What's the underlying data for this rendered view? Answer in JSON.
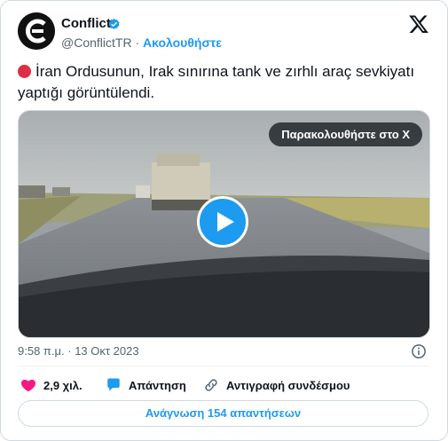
{
  "author": {
    "name": "Conflict",
    "handle": "@ConflictTR",
    "separator": "·",
    "follow_label": "Ακολουθήστε",
    "verified": true
  },
  "tweet": {
    "text": "İran Ordusunun, Irak sınırına tank ve zırhlı araç sevkiyatı yaptığı görüntülendi.",
    "emoji": "red-circle"
  },
  "media": {
    "watch_label": "Παρακολουθήστε στο X",
    "play_icon": "play-icon"
  },
  "meta": {
    "time": "9:58 π.μ.",
    "separator": "·",
    "date": "13 Οκτ 2023"
  },
  "actions": {
    "likes": "2,9 χιλ.",
    "reply": "Απάντηση",
    "copy_link": "Αντιγραφή συνδέσμου"
  },
  "read_replies": "Ανάγνωση 154 απαντήσεων",
  "colors": {
    "accent": "#1d9bf0",
    "like": "#f91880",
    "text": "#0f1419",
    "muted": "#536471",
    "border": "#cfd9de",
    "red_dot": "#dd2e44"
  }
}
